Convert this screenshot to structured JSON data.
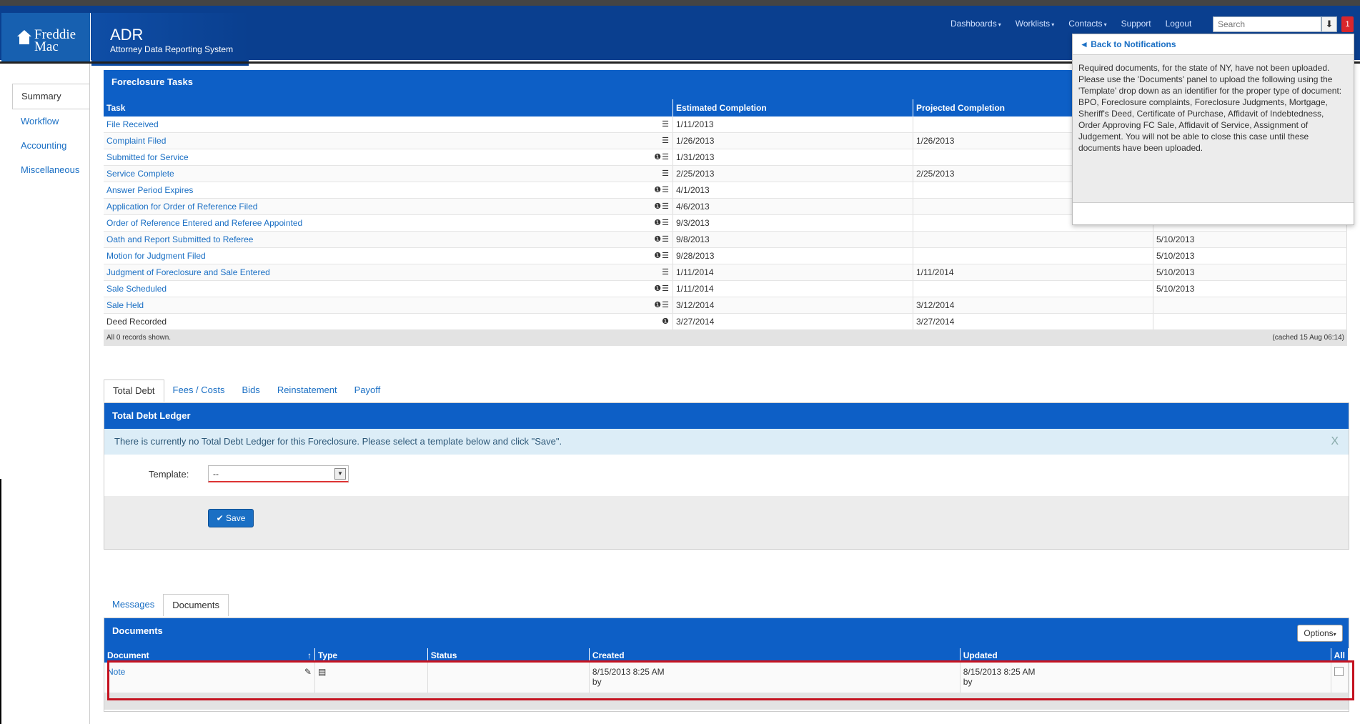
{
  "header": {
    "logo_line1": "Freddie",
    "logo_line2": "Mac",
    "app_title": "ADR",
    "app_subtitle": "Attorney Data Reporting System",
    "nav": [
      "Dashboards",
      "Worklists",
      "Contacts",
      "Support",
      "Logout"
    ],
    "search_placeholder": "Search",
    "notification_count": "1"
  },
  "sidebar": {
    "items": [
      "Summary",
      "Workflow",
      "Accounting",
      "Miscellaneous"
    ]
  },
  "tasks_panel": {
    "title": "Foreclosure Tasks",
    "columns": [
      "Task",
      "Estimated Completion",
      "Projected Completion",
      ""
    ],
    "rows": [
      {
        "task": "File Received",
        "icons": "☰",
        "est": "1/11/2013",
        "proj": "",
        "last": ""
      },
      {
        "task": "Complaint Filed",
        "icons": "☰",
        "est": "1/26/2013",
        "proj": "1/26/2013",
        "last": ""
      },
      {
        "task": "Submitted for Service",
        "icons": "❶☰",
        "est": "1/31/2013",
        "proj": "",
        "last": ""
      },
      {
        "task": "Service Complete",
        "icons": "☰",
        "est": "2/25/2013",
        "proj": "2/25/2013",
        "last": ""
      },
      {
        "task": "Answer Period Expires",
        "icons": "❶☰",
        "est": "4/1/2013",
        "proj": "",
        "last": ""
      },
      {
        "task": "Application for Order of Reference Filed",
        "icons": "❶☰",
        "est": "4/6/2013",
        "proj": "",
        "last": ""
      },
      {
        "task": "Order of Reference Entered and Referee Appointed",
        "icons": "❶☰",
        "est": "9/3/2013",
        "proj": "",
        "last": ""
      },
      {
        "task": "Oath and Report Submitted to Referee",
        "icons": "❶☰",
        "est": "9/8/2013",
        "proj": "",
        "last": "5/10/2013"
      },
      {
        "task": "Motion for Judgment Filed",
        "icons": "❶☰",
        "est": "9/28/2013",
        "proj": "",
        "last": "5/10/2013"
      },
      {
        "task": "Judgment of Foreclosure and Sale Entered",
        "icons": "☰",
        "est": "1/11/2014",
        "proj": "1/11/2014",
        "last": "5/10/2013"
      },
      {
        "task": "Sale Scheduled",
        "icons": "❶☰",
        "est": "1/11/2014",
        "proj": "",
        "last": "5/10/2013"
      },
      {
        "task": "Sale Held",
        "icons": "❶☰",
        "est": "3/12/2014",
        "proj": "3/12/2014",
        "last": ""
      },
      {
        "task": "Deed Recorded",
        "icons": "❶",
        "est": "3/27/2014",
        "proj": "3/27/2014",
        "last": ""
      }
    ],
    "footer_left": "All 0 records shown.",
    "footer_right": "(cached 15 Aug 06:14)"
  },
  "notification": {
    "back_label": "◄ Back to Notifications",
    "message": "Required documents, for the state of NY, have not been uploaded. Please use the 'Documents' panel to upload the following using the 'Template' drop down as an identifier for the proper type of document: BPO, Foreclosure complaints, Foreclosure Judgments, Mortgage, Sheriff's Deed, Certificate of Purchase, Affidavit of Indebtedness, Order Approving FC Sale, Affidavit of Service, Assignment of Judgement. You will not be able to close this case until these documents have been uploaded."
  },
  "debt_tabs": [
    "Total Debt",
    "Fees / Costs",
    "Bids",
    "Reinstatement",
    "Payoff"
  ],
  "ledger": {
    "title": "Total Debt Ledger",
    "info": "There is currently no Total Debt Ledger for this Foreclosure. Please select a template below and click \"Save\".",
    "close": "X",
    "template_label": "Template:",
    "template_value": "--",
    "save_label": "Save"
  },
  "doc_tabs": [
    "Messages",
    "Documents"
  ],
  "documents": {
    "title": "Documents",
    "options_label": "Options",
    "columns": [
      "Document",
      "Type",
      "Status",
      "Created",
      "Updated",
      "All"
    ],
    "rows": [
      {
        "document": "Note",
        "status": "",
        "created": "8/15/2013 8:25 AM",
        "created_by": "by",
        "updated": "8/15/2013 8:25 AM",
        "updated_by": "by"
      }
    ]
  }
}
